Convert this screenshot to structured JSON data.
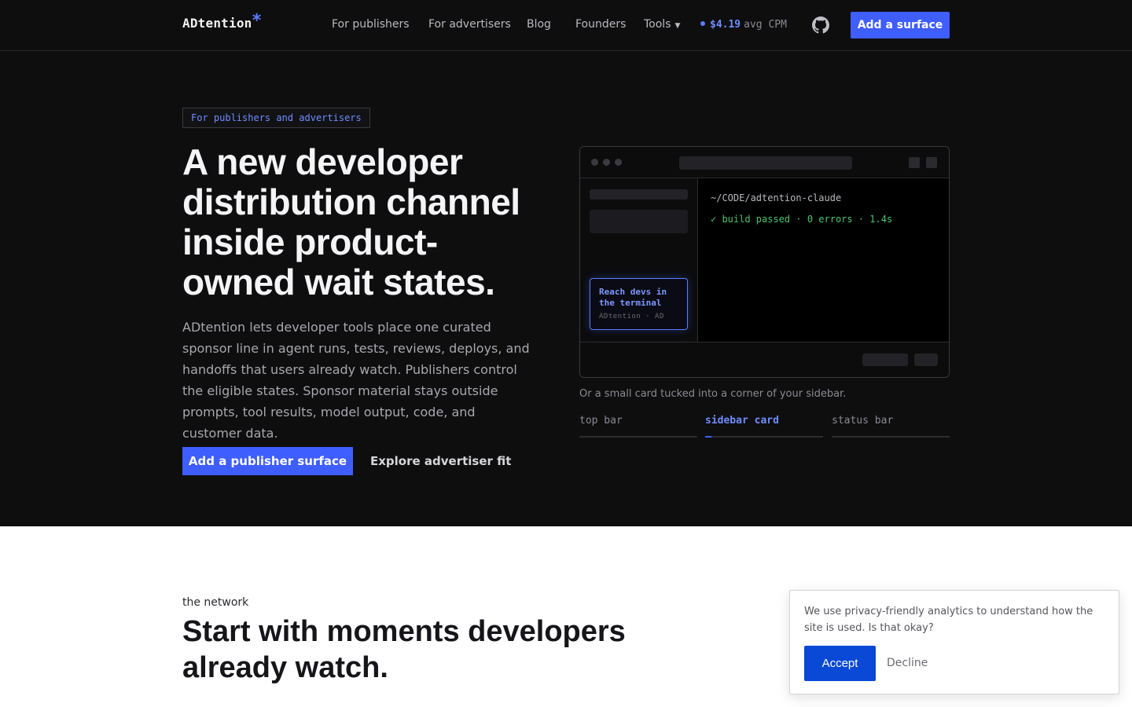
{
  "nav": {
    "logo": "ADtention",
    "logo_mark": "*",
    "links": [
      "For publishers",
      "For advertisers",
      "Blog",
      "Founders"
    ],
    "tools": "Tools",
    "cpm_value": "$4.19",
    "cpm_unit": "avg CPM",
    "cta": "Add a surface",
    "github_icon": "github-icon",
    "colors": {
      "accent": "#3f5eff",
      "background": "#0e0e0f"
    }
  },
  "hero": {
    "badge": "For publishers and advertisers",
    "title": "A new developer distribution channel inside product-owned wait states.",
    "lede": "ADtention lets developer tools place one curated sponsor line in agent runs, tests, reviews, deploys, and handoffs that users already watch. Publishers control the eligible states. Sponsor material stays outside prompts, tool results, model output, code, and customer data.",
    "primary_cta": "Add a publisher surface",
    "secondary_cta": "Explore advertiser fit",
    "mock": {
      "ad_title": "Reach devs in the terminal",
      "ad_sub": "ADtention · AD",
      "terminal_path": "~/CODE/adtention-claude",
      "terminal_status": "✓ build passed · 0 errors · 1.4s"
    },
    "caption": "Or a small card tucked into a corner of your sidebar.",
    "tabs": [
      "top bar",
      "sidebar card",
      "status bar"
    ],
    "active_tab": "sidebar card"
  },
  "network": {
    "eyebrow": "the network",
    "title": "Start with moments developers already watch."
  },
  "cookie": {
    "text": "We use privacy-friendly analytics to understand how the site is used. Is that okay?",
    "accept": "Accept",
    "decline": "Decline"
  }
}
